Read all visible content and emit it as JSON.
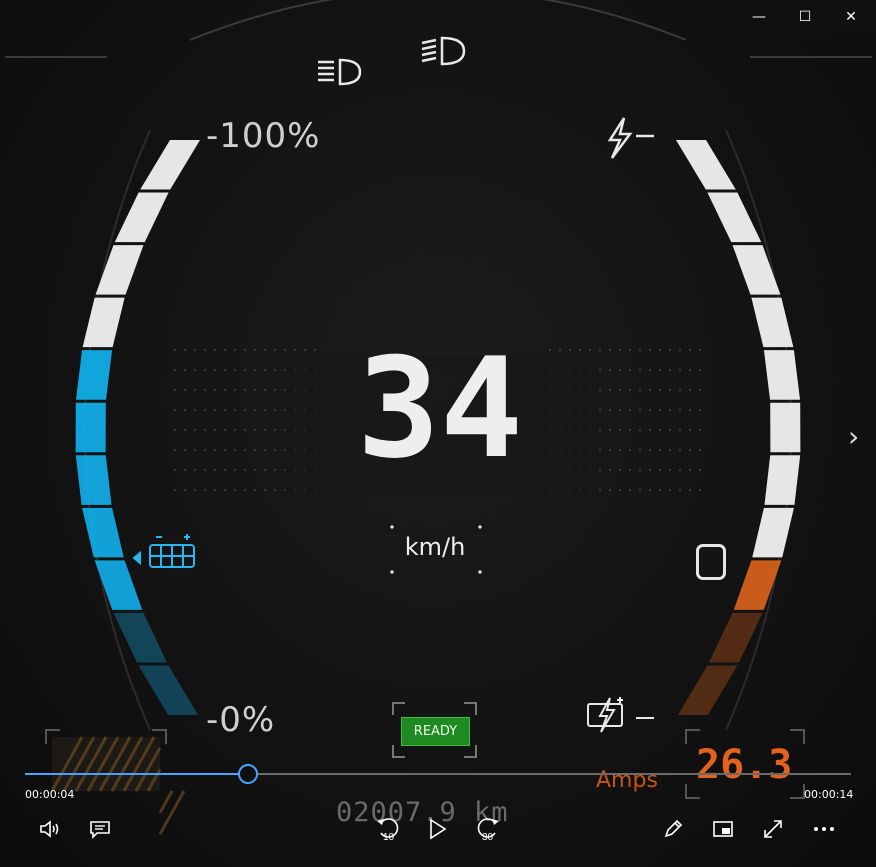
{
  "window": {
    "controls": {
      "minimize": "—",
      "maximize": "☐",
      "close": "✕"
    }
  },
  "dashboard": {
    "battery_top_label": "-100%",
    "battery_bottom_label": "-0%",
    "speed": "34",
    "speed_unit": "km/h",
    "ready_label": "READY",
    "current_value": "26.3",
    "current_unit": "Amps",
    "odometer": "02007.9 km",
    "battery_level_fraction": 0.6,
    "current_level_fraction": 0.3,
    "colors": {
      "battery": "#12b3f0",
      "current": "#e2661b",
      "ready": "#1f8a22"
    }
  },
  "player": {
    "elapsed": "00:00:04",
    "total": "00:00:14",
    "progress_fraction": 0.27,
    "skip_back_label": "10",
    "skip_forward_label": "30",
    "icons": [
      "volume-icon",
      "captions-icon",
      "rewind-10-icon",
      "play-icon",
      "forward-30-icon",
      "edit-icon",
      "mini-view-icon",
      "fullscreen-icon",
      "more-icon"
    ]
  }
}
